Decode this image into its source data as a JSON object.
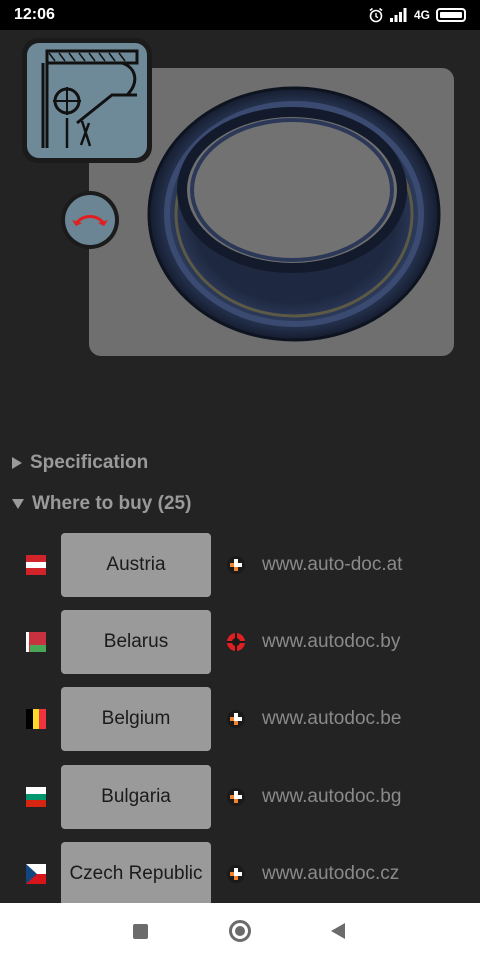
{
  "status_bar": {
    "time": "12:06",
    "network": "4G",
    "icons": [
      "alarm-icon",
      "signal-icon",
      "battery-icon"
    ]
  },
  "product": {
    "diagram_icon": "oil-seal-diagram-icon",
    "rotate_icon": "rotate-arrows-icon",
    "photo_icon": "oil-seal-photo"
  },
  "sections": {
    "specification": "Specification",
    "where_to_buy": "Where to buy (25)"
  },
  "shops": [
    {
      "country": "Austria",
      "url": "www.auto-doc.at",
      "flag": "austria-flag-icon",
      "logo": "autodoc-logo-icon"
    },
    {
      "country": "Belarus",
      "url": "www.autodoc.by",
      "flag": "belarus-flag-icon",
      "logo": "autodoc-red-logo-icon"
    },
    {
      "country": "Belgium",
      "url": "www.autodoc.be",
      "flag": "belgium-flag-icon",
      "logo": "autodoc-logo-icon"
    },
    {
      "country": "Bulgaria",
      "url": "www.autodoc.bg",
      "flag": "bulgaria-flag-icon",
      "logo": "autodoc-logo-icon"
    },
    {
      "country": "Czech Republic",
      "url": "www.autodoc.cz",
      "flag": "czech-flag-icon",
      "logo": "autodoc-logo-icon"
    }
  ],
  "nav": {
    "recents": "square-icon",
    "home": "circle-icon",
    "back": "triangle-back-icon"
  },
  "colors": {
    "background": "#232323",
    "button": "#9a9a9a",
    "accent_blue_gray": "#6e8a98",
    "logo_orange": "#f0822d"
  }
}
